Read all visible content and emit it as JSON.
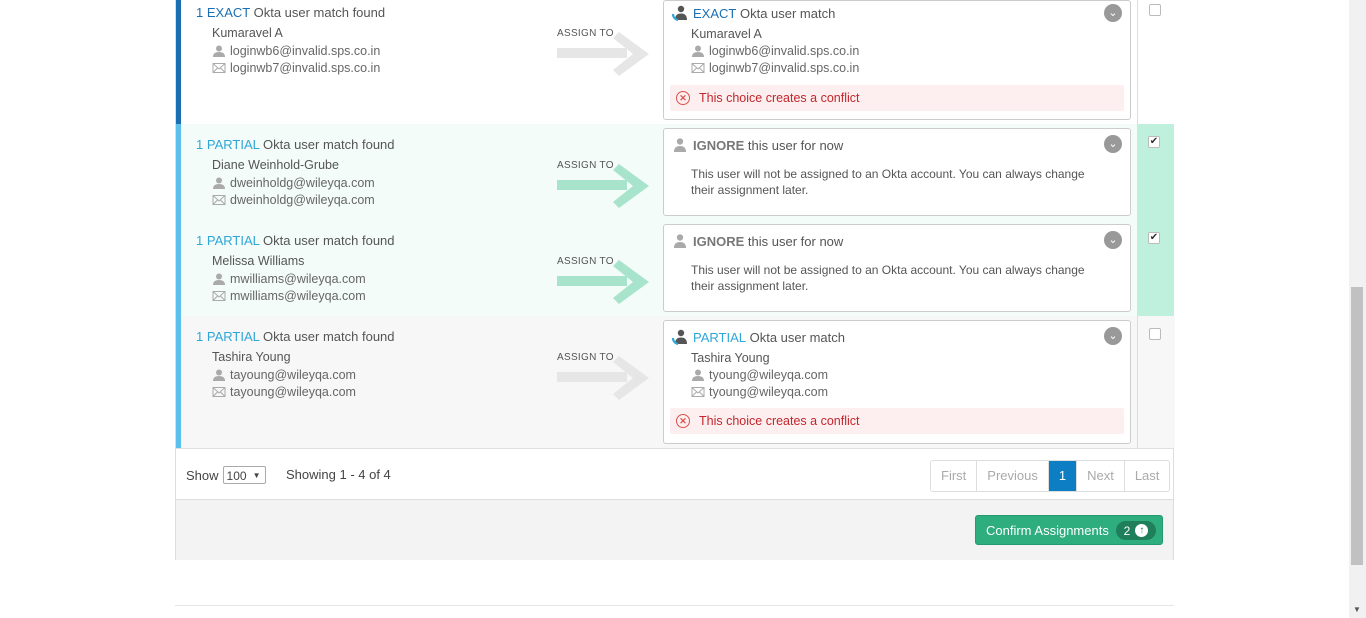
{
  "rows": [
    {
      "count": "1",
      "match_type": "EXACT",
      "match_suffix": "Okta user match found",
      "name": "Kumaravel A",
      "username": "loginwb6@invalid.sps.co.in",
      "email": "loginwb7@invalid.sps.co.in",
      "assign_label": "ASSIGN TO",
      "choice_type": "EXACT",
      "choice_suffix": "Okta user match",
      "choice_name": "Kumaravel A",
      "choice_username": "loginwb6@invalid.sps.co.in",
      "choice_email": "loginwb7@invalid.sps.co.in",
      "conflict": "This choice creates a conflict",
      "checked": false
    },
    {
      "count": "1",
      "match_type": "PARTIAL",
      "match_suffix": "Okta user match found",
      "name": "Diane Weinhold-Grube",
      "username": "dweinholdg@wileyqa.com",
      "email": "dweinholdg@wileyqa.com",
      "assign_label": "ASSIGN TO",
      "choice_type": "IGNORE",
      "choice_suffix": "this user for now",
      "ignore_message": "This user will not be assigned to an Okta account. You can always change their assignment later.",
      "checked": true
    },
    {
      "count": "1",
      "match_type": "PARTIAL",
      "match_suffix": "Okta user match found",
      "name": "Melissa Williams",
      "username": "mwilliams@wileyqa.com",
      "email": "mwilliams@wileyqa.com",
      "assign_label": "ASSIGN TO",
      "choice_type": "IGNORE",
      "choice_suffix": "this user for now",
      "ignore_message": "This user will not be assigned to an Okta account. You can always change their assignment later.",
      "checked": true
    },
    {
      "count": "1",
      "match_type": "PARTIAL",
      "match_suffix": "Okta user match found",
      "name": "Tashira Young",
      "username": "tayoung@wileyqa.com",
      "email": "tayoung@wileyqa.com",
      "assign_label": "ASSIGN TO",
      "choice_type": "PARTIAL",
      "choice_suffix": "Okta user match",
      "choice_name": "Tashira Young",
      "choice_username": "tyoung@wileyqa.com",
      "choice_email": "tyoung@wileyqa.com",
      "conflict": "This choice creates a conflict",
      "checked": false
    }
  ],
  "footer": {
    "show_label": "Show",
    "page_size": "100",
    "showing_text": "Showing 1 - 4 of 4",
    "pager": [
      "First",
      "Previous",
      "1",
      "Next",
      "Last"
    ],
    "current_page": "1"
  },
  "actions": {
    "confirm_label": "Confirm Assignments",
    "confirm_count": "2"
  },
  "colors": {
    "exact": "#1a6fb3",
    "partial": "#2fa6d9",
    "confirm": "#2eae7e",
    "selected_row": "#f3fcf9",
    "selected_check_col": "#bff0de",
    "conflict_text": "#c1272d"
  },
  "icons": {
    "user": "user-icon",
    "mail": "envelope-icon",
    "chevron": "chevron-down-icon",
    "error": "error-circle-icon",
    "upload": "arrow-up-circle-icon"
  }
}
